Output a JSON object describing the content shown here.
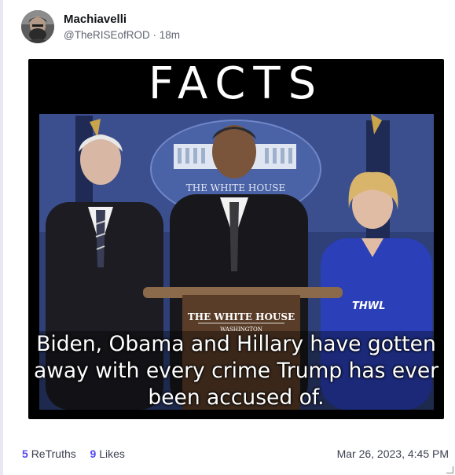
{
  "post": {
    "author_name": "Machiavelli",
    "author_handle": "@TheRISEofROD",
    "separator": "·",
    "time_ago": "18m",
    "timestamp": "Mar 26, 2023, 4:45 PM"
  },
  "media": {
    "headline": "FACTS",
    "podium_sign_line1": "THE WHITE HOUSE",
    "podium_sign_line2": "WASHINGTON",
    "backdrop_seal_text": "THE WHITE HOUSE",
    "watermark": "THWL",
    "caption": "Biden, Obama and Hillary have gotten away with every crime Trump has ever been accused of."
  },
  "stats": {
    "retruths_count": "5",
    "retruths_label": "ReTruths",
    "likes_count": "9",
    "likes_label": "Likes"
  },
  "colors": {
    "accent": "#5448ee",
    "text_primary": "#0f1419",
    "text_secondary": "#5f6470",
    "backdrop_blue": "#3b4f8f",
    "suit_dark": "#1c1c22",
    "hillary_blue": "#2a3fb8"
  }
}
